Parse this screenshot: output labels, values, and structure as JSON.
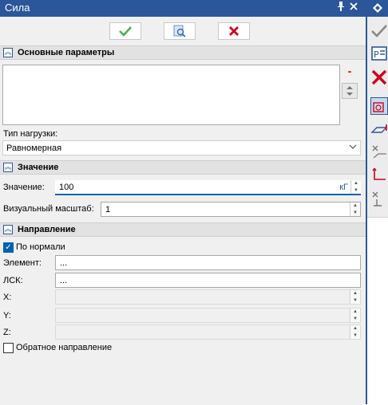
{
  "window": {
    "title": "Сила",
    "pin_icon": "pin-icon",
    "close_icon": "close-icon"
  },
  "toolbar": {
    "ok_icon": "check-icon",
    "preview_icon": "preview-icon",
    "cancel_icon": "cancel-x-icon"
  },
  "sections": {
    "main": {
      "title": "Основные параметры",
      "load_type_label": "Тип нагрузки:",
      "load_type_value": "Равномерная"
    },
    "value": {
      "title": "Значение",
      "value_label": "Значение:",
      "value": "100",
      "value_unit": "кГ",
      "scale_label": "Визуальный масштаб:",
      "scale_value": "1"
    },
    "direction": {
      "title": "Направление",
      "normal_label": "По нормали",
      "normal_checked": true,
      "element_label": "Элемент:",
      "element_value": "...",
      "lcs_label": "ЛСК:",
      "lcs_value": "...",
      "x_label": "X:",
      "y_label": "Y:",
      "z_label": "Z:",
      "reverse_label": "Обратное направление",
      "reverse_checked": false
    }
  },
  "colors": {
    "accent": "#2b579a",
    "check_green": "#4caf50",
    "cancel_red": "#d0021b"
  }
}
